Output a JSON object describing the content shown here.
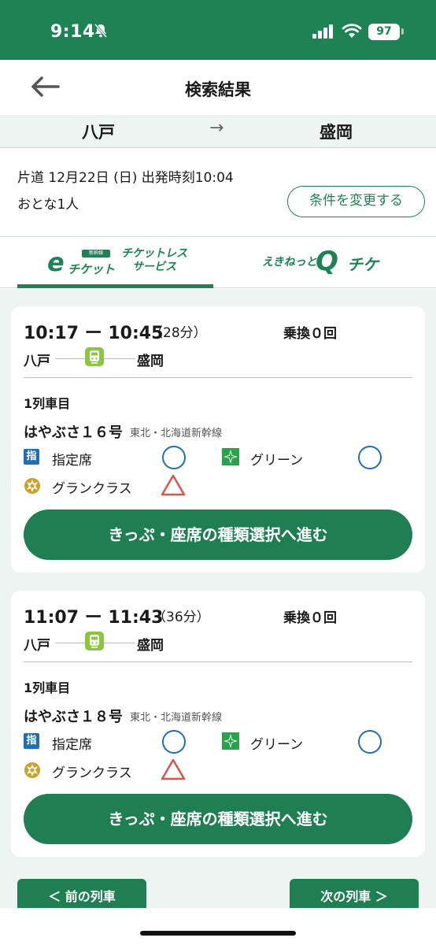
{
  "status_bar": {
    "time": "9:14",
    "battery": "97"
  },
  "header": {
    "title": "検索結果"
  },
  "route": {
    "from": "八戸",
    "arrow": "→",
    "to": "盛岡"
  },
  "conditions": {
    "line1": "片道 12月22日 (日) 出発時刻10:04",
    "line2": "おとな1人",
    "change_button": "条件を変更する"
  },
  "tabs": [
    {
      "logo_main": "e",
      "logo_small": "新幹線",
      "logo_ticket": "チケット",
      "logo_service_1": "チケットレス",
      "logo_service_2": "サービス",
      "selected": true
    },
    {
      "logo_prefix": "えきねっと",
      "logo_q": "Q",
      "logo_suffix": "チケ",
      "selected": false
    }
  ],
  "results": [
    {
      "time_range": "10:17 ー 10:45",
      "duration": "（28分）",
      "transfers": "乗換０回",
      "from": "八戸",
      "to": "盛岡",
      "car_number": "1列車目",
      "train_name": "はやぶさ１６号",
      "line_name": "東北・北海道新幹線",
      "seats": {
        "reserved_icon": "指",
        "reserved_label": "指定席",
        "green_label": "グリーン",
        "gran_label": "グランクラス"
      },
      "button": "きっぷ・座席の種類選択へ進む"
    },
    {
      "time_range": "11:07 ー 11:43",
      "duration": "（36分）",
      "transfers": "乗換０回",
      "from": "八戸",
      "to": "盛岡",
      "car_number": "1列車目",
      "train_name": "はやぶさ１８号",
      "line_name": "東北・北海道新幹線",
      "seats": {
        "reserved_icon": "指",
        "reserved_label": "指定席",
        "green_label": "グリーン",
        "gran_label": "グランクラス"
      },
      "button": "きっぷ・座席の種類選択へ進む"
    }
  ],
  "nav": {
    "prev": "＜ 前の列車",
    "next": "次の列車 ＞"
  },
  "colors": {
    "brand_green": "#1f8254",
    "button_green": "#1f7f53",
    "available_blue": "#1f6fb4",
    "limited_red": "#d9534f",
    "light_bg": "#eef4f1"
  },
  "icons": {
    "back": "left-arrow-icon",
    "silent": "bell-slash-icon",
    "signal": "cellular-signal-icon",
    "wifi": "wifi-icon",
    "train": "train-icon",
    "reserved_seat": "reserved-seat-icon",
    "green_car": "green-car-icon",
    "gran_class": "gran-class-icon",
    "available": "circle-available-icon",
    "limited": "triangle-limited-icon"
  }
}
